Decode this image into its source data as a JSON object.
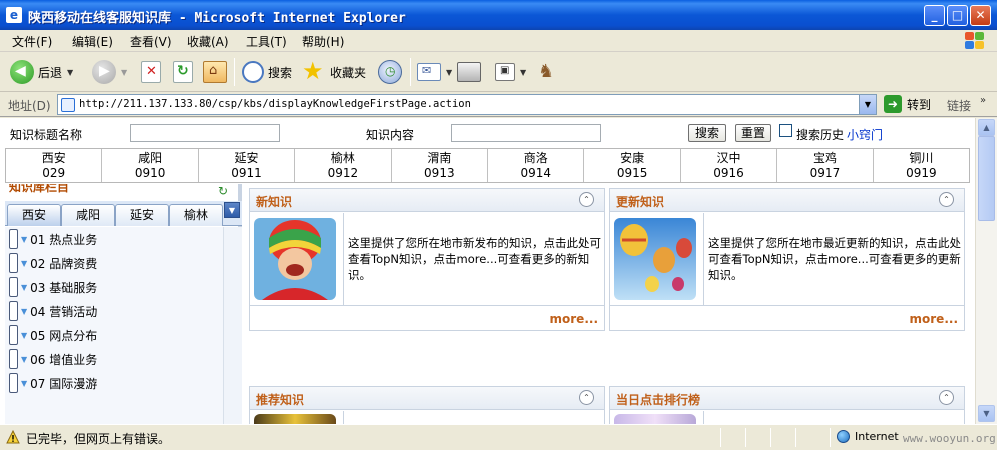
{
  "window": {
    "title": "陕西移动在线客服知识库 - Microsoft Internet Explorer",
    "app_icon": "e"
  },
  "menu": [
    "文件(F)",
    "编辑(E)",
    "查看(V)",
    "收藏(A)",
    "工具(T)",
    "帮助(H)"
  ],
  "toolbar": {
    "back": "后退",
    "search": "搜索",
    "favorites": "收藏夹"
  },
  "address": {
    "label": "地址(D)",
    "url": "http://211.137.133.80/csp/kbs/displayKnowledgeFirstPage.action",
    "go": "转到",
    "links": "链接"
  },
  "search": {
    "title_label": "知识标题名称",
    "content_label": "知识内容",
    "search_button": "搜索",
    "reset_button": "重置",
    "history_label": "搜索历史",
    "tips_link": "小窍门"
  },
  "cities": [
    {
      "name": "西安",
      "code": "029"
    },
    {
      "name": "咸阳",
      "code": "0910"
    },
    {
      "name": "延安",
      "code": "0911"
    },
    {
      "name": "榆林",
      "code": "0912"
    },
    {
      "name": "渭南",
      "code": "0913"
    },
    {
      "name": "商洛",
      "code": "0914"
    },
    {
      "name": "安康",
      "code": "0915"
    },
    {
      "name": "汉中",
      "code": "0916"
    },
    {
      "name": "宝鸡",
      "code": "0917"
    },
    {
      "name": "铜川",
      "code": "0919"
    }
  ],
  "sidebar": {
    "heading": "知识库栏目",
    "tabs": [
      "西安",
      "咸阳",
      "延安",
      "榆林"
    ],
    "items": [
      "01 热点业务",
      "02 品牌资费",
      "03 基础服务",
      "04 营销活动",
      "05 网点分布",
      "06 增值业务",
      "07 国际漫游"
    ]
  },
  "panels": {
    "new": {
      "title": "新知识",
      "text": "这里提供了您所在地市新发布的知识，点击此处可查看TopN知识，点击more...可查看更多的新知识。",
      "more": "more..."
    },
    "updated": {
      "title": "更新知识",
      "text": "这里提供了您所在地市最近更新的知识，点击此处可查看TopN知识，点击more...可查看更多的更新知识。",
      "more": "more..."
    },
    "recommended": {
      "title": "推荐知识"
    },
    "ranking": {
      "title": "当日点击排行榜"
    }
  },
  "status": {
    "text": "已完毕，但网页上有错误。",
    "zone": "Internet"
  },
  "watermark": "www.wooyun.org"
}
